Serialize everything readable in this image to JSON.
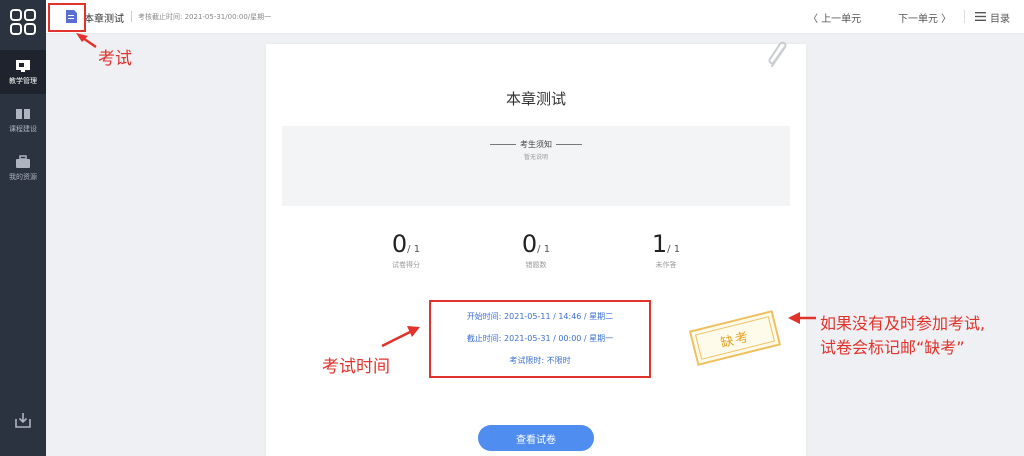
{
  "sidebar": {
    "items": [
      {
        "label": "教学管理",
        "icon": "teaching-icon",
        "active": true
      },
      {
        "label": "课程建设",
        "icon": "book-icon",
        "active": false
      },
      {
        "label": "我的资源",
        "icon": "briefcase-icon",
        "active": false
      }
    ]
  },
  "topbar": {
    "title": "本章测试",
    "deadline": "考核截止时间: 2021-05-31/00:00/星期一",
    "prev": "〈 上一单元",
    "next": "下一单元 〉",
    "menu": "目录"
  },
  "card": {
    "title": "本章测试",
    "notice_title": "考生须知",
    "notice_body": "暂无说明",
    "stats": [
      {
        "num": "0",
        "den": "/ 1",
        "caption": "试卷得分"
      },
      {
        "num": "0",
        "den": "/ 1",
        "caption": "错题数"
      },
      {
        "num": "1",
        "den": "/ 1",
        "caption": "未作答"
      }
    ],
    "start_time": "开始时间:  2021-05-11 / 14:46 / 星期二",
    "end_time": "截止时间:  2021-05-31 / 00:00 / 星期一",
    "limit": "考试限时:  不限时",
    "stamp": "缺考",
    "button": "查看试卷"
  },
  "annotations": {
    "exam": "考试",
    "exam_time": "考试时间",
    "note_line1": "如果没有及时参加考试,",
    "note_line2": "试卷会标记邮“缺考”"
  },
  "colors": {
    "accent": "#4f8ef0",
    "annotation": "#e2322b",
    "sidebar": "#2b3240"
  }
}
